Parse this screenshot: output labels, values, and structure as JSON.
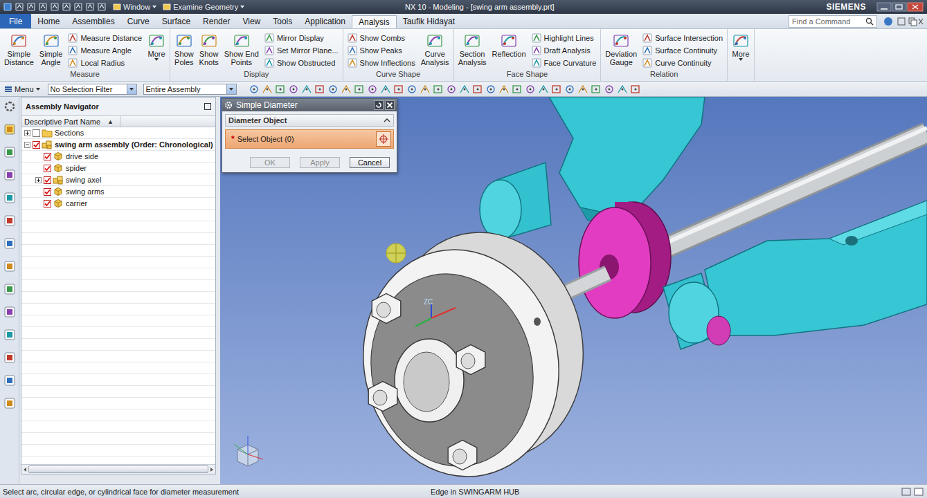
{
  "window": {
    "title": "NX 10 - Modeling - [swing arm assembly.prt]",
    "brand": "SIEMENS",
    "quick_menus": [
      {
        "label": "Window"
      },
      {
        "label": "Examine Geometry"
      }
    ]
  },
  "ribbon_tabs": [
    {
      "label": "File",
      "kind": "file",
      "selected": false
    },
    {
      "label": "Home",
      "kind": "tab",
      "selected": false
    },
    {
      "label": "Assemblies",
      "kind": "tab",
      "selected": false
    },
    {
      "label": "Curve",
      "kind": "tab",
      "selected": false
    },
    {
      "label": "Surface",
      "kind": "tab",
      "selected": false
    },
    {
      "label": "Render",
      "kind": "tab",
      "selected": false
    },
    {
      "label": "View",
      "kind": "tab",
      "selected": false
    },
    {
      "label": "Tools",
      "kind": "tab",
      "selected": false
    },
    {
      "label": "Application",
      "kind": "tab",
      "selected": false
    },
    {
      "label": "Analysis",
      "kind": "tab",
      "selected": true
    },
    {
      "label": "Taufik Hidayat",
      "kind": "tab",
      "selected": false
    }
  ],
  "command_search": {
    "placeholder": "Find a Command"
  },
  "ribbon_groups": [
    {
      "label": "Measure",
      "commands": [
        {
          "kind": "large",
          "lines": [
            "Simple",
            "Distance"
          ],
          "dropdown": false
        },
        {
          "kind": "large",
          "lines": [
            "Simple",
            "Angle"
          ],
          "dropdown": false
        },
        {
          "kind": "small",
          "lines": [
            "Measure Distance"
          ],
          "dropdown": false
        },
        {
          "kind": "small",
          "lines": [
            "Measure Angle"
          ],
          "dropdown": false
        },
        {
          "kind": "small",
          "lines": [
            "Local Radius"
          ],
          "dropdown": false
        },
        {
          "kind": "large",
          "lines": [
            "More"
          ],
          "dropdown": true
        }
      ]
    },
    {
      "label": "Display",
      "commands": [
        {
          "kind": "large",
          "lines": [
            "Show",
            "Poles"
          ],
          "dropdown": false
        },
        {
          "kind": "large",
          "lines": [
            "Show",
            "Knots"
          ],
          "dropdown": false
        },
        {
          "kind": "large",
          "lines": [
            "Show End",
            "Points"
          ],
          "dropdown": false
        },
        {
          "kind": "small",
          "lines": [
            "Mirror Display"
          ],
          "dropdown": false
        },
        {
          "kind": "small",
          "lines": [
            "Set Mirror Plane..."
          ],
          "dropdown": false
        },
        {
          "kind": "small",
          "lines": [
            "Show Obstructed"
          ],
          "dropdown": false
        }
      ]
    },
    {
      "label": "Curve Shape",
      "commands": [
        {
          "kind": "small",
          "lines": [
            "Show Combs"
          ],
          "dropdown": false
        },
        {
          "kind": "small",
          "lines": [
            "Show Peaks"
          ],
          "dropdown": false
        },
        {
          "kind": "small",
          "lines": [
            "Show Inflections"
          ],
          "dropdown": false
        },
        {
          "kind": "large",
          "lines": [
            "Curve",
            "Analysis"
          ],
          "dropdown": false
        }
      ]
    },
    {
      "label": "Face Shape",
      "commands": [
        {
          "kind": "large",
          "lines": [
            "Section",
            "Analysis"
          ],
          "dropdown": false
        },
        {
          "kind": "large",
          "lines": [
            "Reflection"
          ],
          "dropdown": false
        },
        {
          "kind": "small",
          "lines": [
            "Highlight Lines"
          ],
          "dropdown": false
        },
        {
          "kind": "small",
          "lines": [
            "Draft Analysis"
          ],
          "dropdown": false
        },
        {
          "kind": "small",
          "lines": [
            "Face Curvature"
          ],
          "dropdown": false
        }
      ]
    },
    {
      "label": "Relation",
      "commands": [
        {
          "kind": "large",
          "lines": [
            "Deviation",
            "Gauge"
          ],
          "dropdown": false
        },
        {
          "kind": "small",
          "lines": [
            "Surface Intersection"
          ],
          "dropdown": false
        },
        {
          "kind": "small",
          "lines": [
            "Surface Continuity"
          ],
          "dropdown": false
        },
        {
          "kind": "small",
          "lines": [
            "Curve Continuity"
          ],
          "dropdown": false
        }
      ]
    },
    {
      "label": "",
      "commands": [
        {
          "kind": "large",
          "lines": [
            "More"
          ],
          "dropdown": true
        }
      ]
    }
  ],
  "toolbar": {
    "menu": "Menu",
    "filters": [
      {
        "value": "No Selection Filter"
      },
      {
        "value": "Entire Assembly"
      }
    ]
  },
  "navigator": {
    "title": "Assembly Navigator",
    "column": "Descriptive Part Name",
    "sort": "▲",
    "items": [
      {
        "label": "Sections",
        "depth": 0,
        "expandable": true,
        "expanded": false,
        "checked": false,
        "kind": "folder",
        "emphasized": false
      },
      {
        "label": "swing arm assembly (Order: Chronological)",
        "depth": 0,
        "expandable": true,
        "expanded": true,
        "checked": true,
        "kind": "assembly",
        "emphasized": true
      },
      {
        "label": "drive side",
        "depth": 1,
        "expandable": false,
        "expanded": false,
        "checked": true,
        "kind": "part",
        "emphasized": false
      },
      {
        "label": "spider",
        "depth": 1,
        "expandable": false,
        "expanded": false,
        "checked": true,
        "kind": "part",
        "emphasized": false
      },
      {
        "label": "swing axel",
        "depth": 1,
        "expandable": true,
        "expanded": false,
        "checked": true,
        "kind": "assembly",
        "emphasized": false
      },
      {
        "label": "swing arms",
        "depth": 1,
        "expandable": false,
        "expanded": false,
        "checked": true,
        "kind": "part",
        "emphasized": false
      },
      {
        "label": "carrier",
        "depth": 1,
        "expandable": false,
        "expanded": false,
        "checked": true,
        "kind": "part",
        "emphasized": false
      }
    ]
  },
  "dialog": {
    "title": "Simple Diameter",
    "section": "Diameter Object",
    "select": {
      "marker": "*",
      "label": "Select Object (0)"
    },
    "buttons": [
      {
        "label": "OK",
        "disabled": true
      },
      {
        "label": "Apply",
        "disabled": true
      },
      {
        "label": "Cancel",
        "disabled": false
      }
    ]
  },
  "viewport": {
    "triad_label": "ZC"
  },
  "status_bar": {
    "prompt": "Select arc, circular edge, or cylindrical face for diameter measurement",
    "selection": "Edge in SWINGARM HUB"
  }
}
